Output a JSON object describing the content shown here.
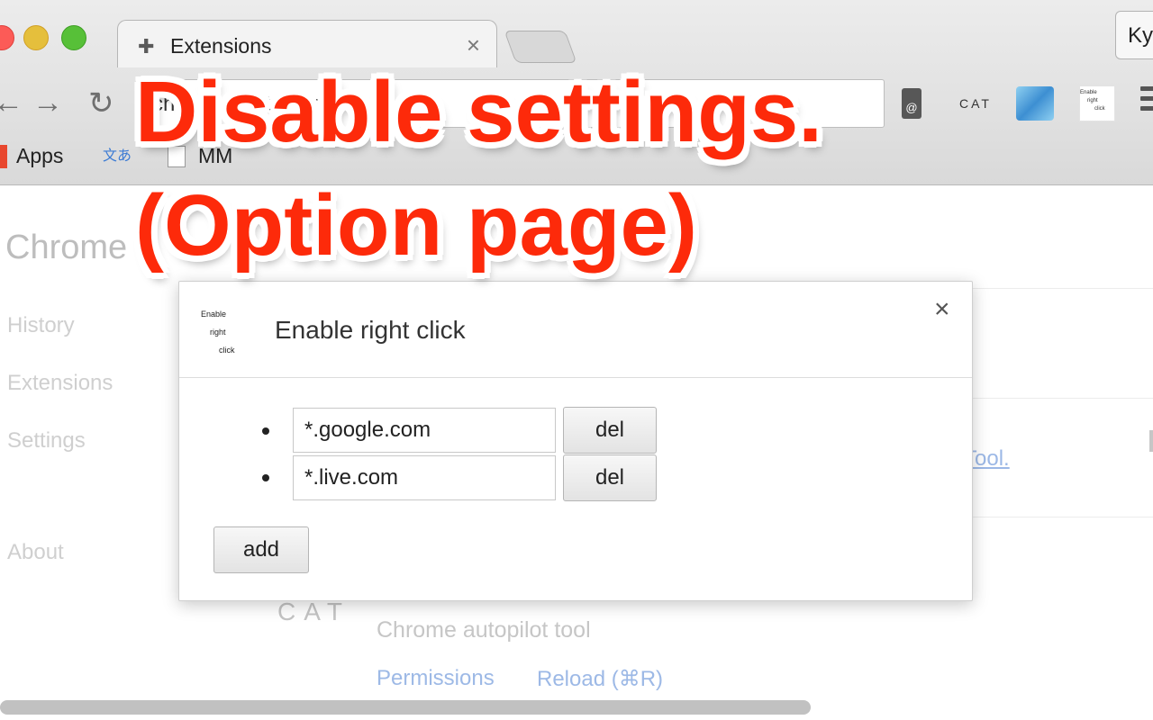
{
  "browser": {
    "tab": {
      "title": "Extensions",
      "close_glyph": "×"
    },
    "profile_label": "Ky",
    "omnibox_text": "chrome://extensions",
    "toolbar_ext": {
      "cat_label": "CAT"
    },
    "ext_erc_lines": [
      "Enable",
      "right",
      "click"
    ],
    "bookmarks": {
      "apps": "Apps",
      "mm": "MM",
      "translate_glyph": "文あ"
    }
  },
  "page": {
    "title": "Chrome",
    "sidebar": [
      "History",
      "Extensions",
      "Settings",
      "About"
    ],
    "tool_link": "Tool.",
    "cat_logo": "CAT",
    "cat_description": "Chrome autopilot tool",
    "links": {
      "permissions": "Permissions",
      "reload": "Reload (⌘R)"
    }
  },
  "dialog": {
    "icon_lines": [
      "Enable",
      "right",
      "click"
    ],
    "title": "Enable right click",
    "close_glyph": "×",
    "sites": [
      {
        "value": "*.google.com",
        "del_label": "del"
      },
      {
        "value": "*.live.com",
        "del_label": "del"
      }
    ],
    "add_label": "add"
  },
  "caption": {
    "line1": "Disable settings.",
    "line2": "(Option page)"
  },
  "colors": {
    "caption_red": "#fd2a0a",
    "link_blue": "#9db9e6"
  }
}
